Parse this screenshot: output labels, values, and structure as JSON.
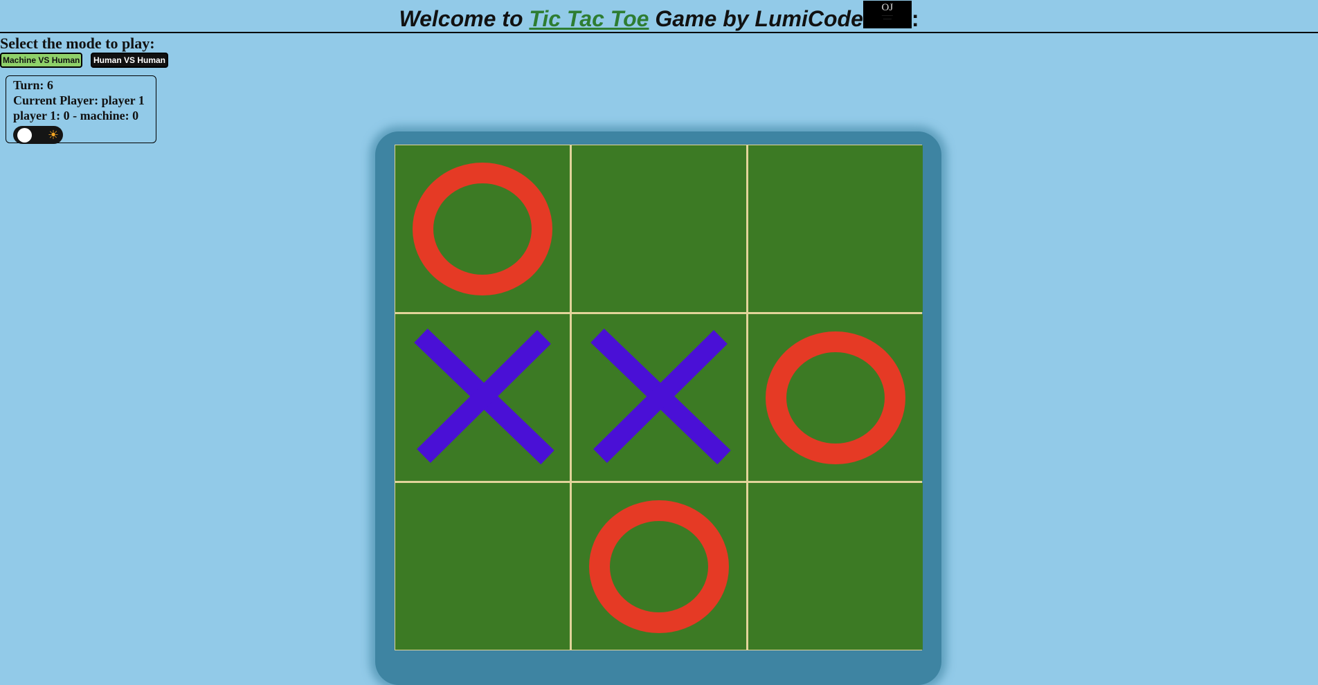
{
  "header": {
    "prefix": "Welcome to ",
    "link_text": "Tic Tac Toe",
    "suffix": " Game by LumiCode ",
    "logo_mark": "OJ",
    "colon": ":"
  },
  "mode": {
    "label": "Select the mode to play:",
    "machine_button": "Machine VS Human",
    "human_button": "Human VS Human"
  },
  "status": {
    "turn": "Turn: 6",
    "current_player": "Current Player: player 1",
    "score": "player 1: 0 - machine: 0"
  },
  "theme_toggle": {
    "icon": "sun-icon",
    "sun_glyph": "☀"
  },
  "colors": {
    "background": "#92cae8",
    "board_frame": "#3e84a2",
    "cell": "#3c7a24",
    "grid_lines": "#e2d49a",
    "o_mark": "#e53a25",
    "x_mark": "#4a10d6"
  },
  "board": {
    "cells": [
      "O",
      "",
      "",
      "X",
      "X",
      "O",
      "",
      "O",
      ""
    ]
  }
}
